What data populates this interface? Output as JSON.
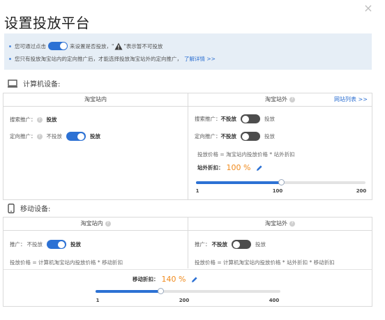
{
  "dialog": {
    "title": "设置投放平台",
    "close_glyph": "×"
  },
  "notice": {
    "line1_prefix": "您可通过点击",
    "line1_mid": "来设置是否投放，\"",
    "line1_suffix": "\"表示暂不可投放",
    "line2_text": "您只有投放淘宝站内的定向推广后，才能选择投放淘宝站外的定向推广，",
    "line2_link": "了解详情 >>"
  },
  "computer": {
    "section_label": "计算机设备:",
    "inside": {
      "header": "淘宝站内",
      "search": {
        "label": "搜索推广：",
        "value": "投放"
      },
      "targeting": {
        "label": "定向推广：",
        "off_text": "不投放",
        "on_text": "投放",
        "state": "on"
      }
    },
    "outside": {
      "header": "淘宝站外",
      "header_link": "网站列表 >>",
      "search": {
        "label": "搜索推广：",
        "off_text": "不投放",
        "on_text": "投放",
        "state": "off"
      },
      "targeting": {
        "label": "定向推广：",
        "off_text": "不投放",
        "on_text": "投放",
        "state": "off"
      },
      "formula": "投放价格 = 淘宝站内投放价格 * 站外折扣",
      "discount_label": "站外折扣：",
      "discount_value": "100 %",
      "slider": {
        "min_label": "1",
        "mid_label": "100",
        "max_label": "200",
        "value_fraction": 0.5
      }
    }
  },
  "mobile": {
    "section_label": "移动设备:",
    "inside": {
      "header": "淘宝站内",
      "promo": {
        "label": "推广：",
        "off_text": "不投放",
        "on_text": "投放",
        "state": "on"
      },
      "formula": "投放价格 = 计算机淘宝站内投放价格 * 移动折扣"
    },
    "outside": {
      "header": "淘宝站外",
      "promo": {
        "label": "推广：",
        "off_text": "不投放",
        "on_text": "投放",
        "state": "off"
      },
      "formula": "投放价格 = 计算机淘宝站内投放价格 * 站外折扣 * 移动折扣"
    },
    "discount_label": "移动折扣：",
    "discount_value": "140 %",
    "slider": {
      "min_label": "1",
      "mid_label": "200",
      "max_label": "400",
      "value_fraction": 0.35
    }
  },
  "icons": {
    "warning": "warning-icon",
    "computer": "monitor-icon",
    "mobile": "phone-icon",
    "help": "help-icon",
    "edit": "pencil-icon",
    "close": "close-icon"
  },
  "colors": {
    "accent": "#2c71d4",
    "link": "#2c6fd1",
    "highlight": "#f08a1c",
    "notice_bg": "#e6eef6",
    "toggle_off": "#4d4d4d"
  }
}
